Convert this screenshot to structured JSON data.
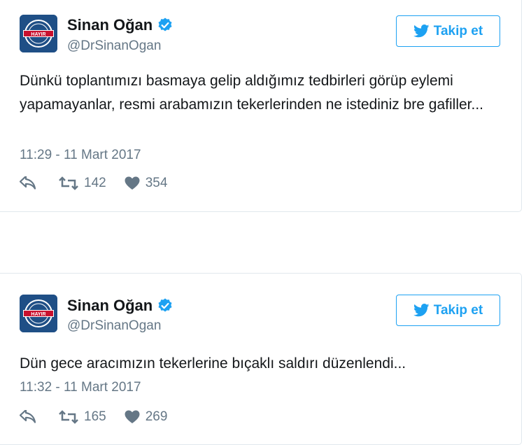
{
  "colors": {
    "accent": "#1da1f2",
    "secondary_text": "#657786",
    "border": "#e1e8ed",
    "avatar_bg": "#1f4f86"
  },
  "tweets": [
    {
      "display_name": "Sinan Oğan",
      "handle": "@DrSinanOgan",
      "avatar_label": "HAYIR",
      "follow_label": "Takip et",
      "text": "Dünkü toplantımızı basmaya gelip aldığımız tedbirleri görüp eylemi yapamayanlar, resmi arabamızın tekerlerinden ne istediniz bre gafiller...",
      "timestamp": "11:29 - 11 Mart 2017",
      "retweets": "142",
      "likes": "354",
      "icons": {
        "reply": "reply-icon",
        "retweet": "retweet-icon",
        "like": "heart-icon",
        "verified": "verified-badge-icon",
        "follow": "twitter-bird-icon"
      }
    },
    {
      "display_name": "Sinan Oğan",
      "handle": "@DrSinanOgan",
      "avatar_label": "HAYIR",
      "follow_label": "Takip et",
      "text": "Dün gece aracımızın tekerlerine bıçaklı saldırı düzenlendi...",
      "timestamp": "11:32 - 11 Mart 2017",
      "retweets": "165",
      "likes": "269",
      "icons": {
        "reply": "reply-icon",
        "retweet": "retweet-icon",
        "like": "heart-icon",
        "verified": "verified-badge-icon",
        "follow": "twitter-bird-icon"
      }
    }
  ]
}
